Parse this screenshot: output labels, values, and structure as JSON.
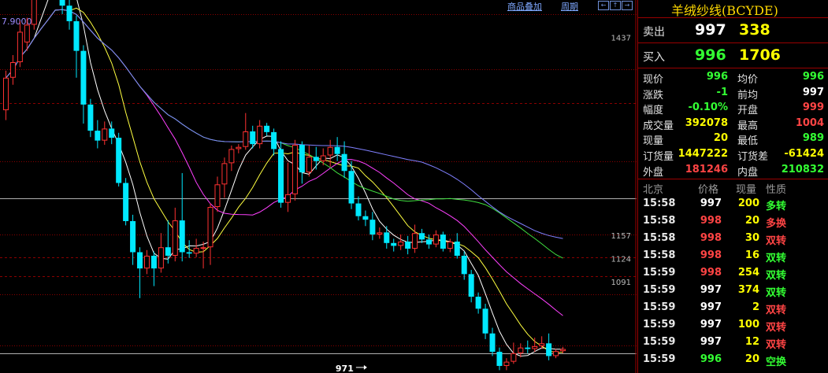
{
  "toolbar": {
    "overlay_label": "商品叠加",
    "period_label": "周期",
    "nav_left": "←",
    "nav_up": "↑",
    "nav_right": "→"
  },
  "chart_data": {
    "type": "candlestick",
    "top_left_value": "7.9000",
    "price_range": [
      962,
      1490
    ],
    "annotations": [
      {
        "text": "1437",
        "value": 1437
      },
      {
        "text": "1157",
        "value": 1157
      },
      {
        "text": "1124",
        "value": 1124
      },
      {
        "text": "1091",
        "value": 1091
      }
    ],
    "low_marker": {
      "text": "971",
      "value": 971,
      "index": 52
    },
    "candles": [
      [
        1334,
        1380,
        1320,
        1390
      ],
      [
        1380,
        1402,
        1370,
        1412
      ],
      [
        1402,
        1445,
        1395,
        1460
      ],
      [
        1430,
        1455,
        1418,
        1465
      ],
      [
        1455,
        1497,
        1448,
        1510
      ],
      [
        1497,
        1518,
        1490,
        1530
      ],
      [
        1518,
        1540,
        1510,
        1555
      ],
      [
        1545,
        1568,
        1538,
        1574
      ],
      [
        1572,
        1482,
        1470,
        1578
      ],
      [
        1482,
        1460,
        1448,
        1490
      ],
      [
        1460,
        1418,
        1380,
        1468
      ],
      [
        1418,
        1342,
        1315,
        1426
      ],
      [
        1342,
        1305,
        1296,
        1350
      ],
      [
        1305,
        1291,
        1280,
        1320
      ],
      [
        1291,
        1308,
        1285,
        1318
      ],
      [
        1308,
        1295,
        1286,
        1318
      ],
      [
        1295,
        1231,
        1226,
        1302
      ],
      [
        1231,
        1177,
        1171,
        1238
      ],
      [
        1177,
        1133,
        1115,
        1186
      ],
      [
        1133,
        1110,
        1068,
        1140
      ],
      [
        1110,
        1128,
        1102,
        1136
      ],
      [
        1128,
        1110,
        1085,
        1134
      ],
      [
        1110,
        1140,
        1104,
        1160
      ],
      [
        1140,
        1128,
        1117,
        1178
      ],
      [
        1128,
        1178,
        1120,
        1196
      ],
      [
        1178,
        1133,
        1120,
        1245
      ],
      [
        1133,
        1131,
        1125,
        1150
      ],
      [
        1131,
        1139,
        1126,
        1152
      ],
      [
        1139,
        1140,
        1110,
        1148
      ],
      [
        1140,
        1197,
        1115,
        1202
      ],
      [
        1197,
        1229,
        1190,
        1240
      ],
      [
        1229,
        1259,
        1210,
        1267
      ],
      [
        1259,
        1279,
        1248,
        1284
      ],
      [
        1279,
        1282,
        1273,
        1286
      ],
      [
        1282,
        1304,
        1278,
        1330
      ],
      [
        1304,
        1286,
        1280,
        1312
      ],
      [
        1286,
        1312,
        1280,
        1320
      ],
      [
        1312,
        1303,
        1298,
        1316
      ],
      [
        1303,
        1279,
        1270,
        1308
      ],
      [
        1279,
        1203,
        1196,
        1290
      ],
      [
        1203,
        1215,
        1190,
        1260
      ],
      [
        1215,
        1285,
        1206,
        1292
      ],
      [
        1285,
        1246,
        1230,
        1290
      ],
      [
        1246,
        1268,
        1240,
        1284
      ],
      [
        1268,
        1262,
        1250,
        1282
      ],
      [
        1262,
        1270,
        1256,
        1280
      ],
      [
        1270,
        1282,
        1254,
        1292
      ],
      [
        1282,
        1272,
        1262,
        1296
      ],
      [
        1272,
        1248,
        1238,
        1290
      ],
      [
        1248,
        1202,
        1194,
        1262
      ],
      [
        1202,
        1184,
        1178,
        1212
      ],
      [
        1184,
        1179,
        1170,
        1192
      ],
      [
        1179,
        1158,
        1150,
        1190
      ],
      [
        1158,
        1161,
        1152,
        1168
      ],
      [
        1161,
        1146,
        1138,
        1170
      ],
      [
        1146,
        1142,
        1134,
        1152
      ],
      [
        1142,
        1148,
        1136,
        1158
      ],
      [
        1148,
        1138,
        1130,
        1156
      ],
      [
        1138,
        1160,
        1132,
        1172
      ],
      [
        1160,
        1151,
        1146,
        1166
      ],
      [
        1151,
        1144,
        1138,
        1158
      ],
      [
        1144,
        1158,
        1140,
        1164
      ],
      [
        1158,
        1138,
        1134,
        1162
      ],
      [
        1138,
        1148,
        1133,
        1152
      ],
      [
        1148,
        1128,
        1124,
        1160
      ],
      [
        1128,
        1102,
        1094,
        1134
      ],
      [
        1102,
        1070,
        1062,
        1108
      ],
      [
        1070,
        1053,
        1046,
        1076
      ],
      [
        1053,
        1018,
        1010,
        1060
      ],
      [
        1018,
        992,
        986,
        1026
      ],
      [
        992,
        972,
        966,
        998
      ],
      [
        972,
        978,
        966,
        983
      ],
      [
        978,
        990,
        975,
        1005
      ],
      [
        990,
        998,
        984,
        1004
      ],
      [
        998,
        996,
        990,
        1008
      ],
      [
        996,
        1000,
        992,
        1012
      ],
      [
        1000,
        1004,
        996,
        1014
      ],
      [
        1004,
        986,
        980,
        1018
      ],
      [
        986,
        993,
        983,
        996
      ],
      [
        993,
        996,
        990,
        999
      ]
    ],
    "ma_lines": [
      {
        "name": "MA5",
        "color": "#ffffff"
      },
      {
        "name": "MA10",
        "color": "#ffff40"
      },
      {
        "name": "MA20",
        "color": "#ff40ff"
      },
      {
        "name": "MA40",
        "color": "#40e040"
      },
      {
        "name": "MA60",
        "color": "#8080ff"
      }
    ],
    "colors": {
      "up": "#ff3232",
      "down": "#00e8ff"
    }
  },
  "panel": {
    "title": "羊绒纱线(BCYDE)",
    "ask": {
      "label": "卖出",
      "price": "997",
      "volume": "338",
      "price_color": "#ffffff"
    },
    "bid": {
      "label": "买入",
      "price": "996",
      "volume": "1706",
      "price_color": "#33ff33"
    },
    "quote_rows": [
      {
        "l1": "现价",
        "v1": "996",
        "c1": "#33ff33",
        "l2": "均价",
        "v2": "996",
        "c2": "#33ff33"
      },
      {
        "l1": "涨跌",
        "v1": "-1",
        "c1": "#33ff33",
        "l2": "前均",
        "v2": "997",
        "c2": "#ffffff"
      },
      {
        "l1": "幅度",
        "v1": "-0.10%",
        "c1": "#33ff33",
        "l2": "开盘",
        "v2": "999",
        "c2": "#ff4444"
      },
      {
        "l1": "成交量",
        "v1": "392078",
        "c1": "#ffff00",
        "l2": "最高",
        "v2": "1004",
        "c2": "#ff4444"
      },
      {
        "l1": "现量",
        "v1": "20",
        "c1": "#ffff00",
        "l2": "最低",
        "v2": "989",
        "c2": "#33ff33"
      },
      {
        "l1": "订货量",
        "v1": "1447222",
        "c1": "#ffff00",
        "l2": "订货差",
        "v2": "-61424",
        "c2": "#ffff00"
      },
      {
        "l1": "外盘",
        "v1": "181246",
        "c1": "#ff4444",
        "l2": "内盘",
        "v2": "210832",
        "c2": "#33ff33"
      }
    ],
    "trade_headers": {
      "time": "北京",
      "price": "价格",
      "volume": "现量",
      "nature": "性质"
    },
    "trades": [
      {
        "time": "15:58",
        "price": "997",
        "volume": "200",
        "nature": "多转",
        "pc": "#ffffff",
        "nc": "#33ff33"
      },
      {
        "time": "15:58",
        "price": "998",
        "volume": "20",
        "nature": "多换",
        "pc": "#ff4444",
        "nc": "#ff4444"
      },
      {
        "time": "15:58",
        "price": "998",
        "volume": "30",
        "nature": "双转",
        "pc": "#ff4444",
        "nc": "#ff4444"
      },
      {
        "time": "15:58",
        "price": "998",
        "volume": "16",
        "nature": "双转",
        "pc": "#ff4444",
        "nc": "#33ff33"
      },
      {
        "time": "15:59",
        "price": "998",
        "volume": "254",
        "nature": "双转",
        "pc": "#ff4444",
        "nc": "#33ff33"
      },
      {
        "time": "15:59",
        "price": "997",
        "volume": "374",
        "nature": "双转",
        "pc": "#ffffff",
        "nc": "#33ff33"
      },
      {
        "time": "15:59",
        "price": "997",
        "volume": "2",
        "nature": "双转",
        "pc": "#ffffff",
        "nc": "#ff4444"
      },
      {
        "time": "15:59",
        "price": "997",
        "volume": "100",
        "nature": "双转",
        "pc": "#ffffff",
        "nc": "#ff4444"
      },
      {
        "time": "15:59",
        "price": "997",
        "volume": "12",
        "nature": "双转",
        "pc": "#ffffff",
        "nc": "#ff4444"
      },
      {
        "time": "15:59",
        "price": "996",
        "volume": "20",
        "nature": "空换",
        "pc": "#33ff33",
        "nc": "#33ff33"
      }
    ]
  }
}
